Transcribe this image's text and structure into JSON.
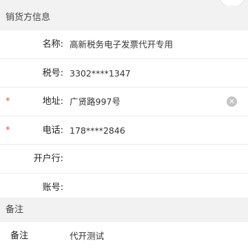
{
  "seller_section": {
    "title": "销货方信息",
    "fields": {
      "name": {
        "label": "名称:",
        "value": "高新税务电子发票代开专用"
      },
      "tax_id": {
        "label": "税号:",
        "value": "3302****1347"
      },
      "address": {
        "label": "地址:",
        "value": "广贤路997号",
        "required_mark": "*"
      },
      "phone": {
        "label": "电话:",
        "value": "178****2846",
        "required_mark": "*"
      },
      "bank": {
        "label": "开户行:",
        "value": ""
      },
      "account": {
        "label": "账号:",
        "value": ""
      }
    },
    "clear_icon": "clear-circle-icon"
  },
  "remark_section": {
    "title": "备注",
    "label": "备注",
    "value": "代开测试"
  },
  "colors": {
    "background": "#f2f2f2",
    "panel": "#ffffff",
    "required": "#e54d42",
    "divider": "#ececec",
    "clear_icon": "#c4c4c4"
  }
}
